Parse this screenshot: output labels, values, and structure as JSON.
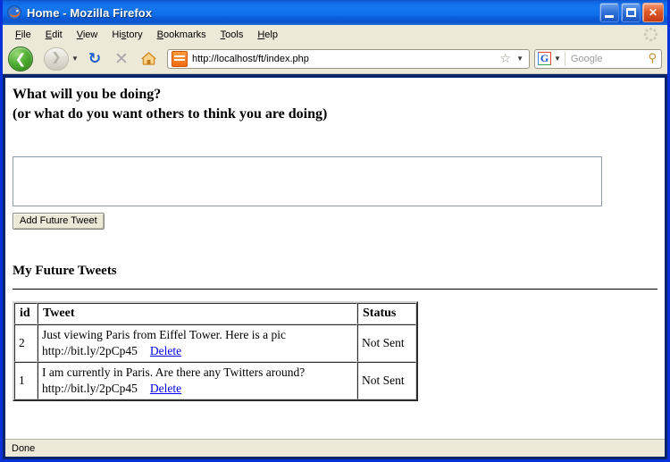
{
  "window": {
    "title": "Home - Mozilla Firefox",
    "app_icon": "firefox-icon",
    "buttons": {
      "minimize": "minimize-button",
      "maximize": "maximize-button",
      "close": "✕"
    }
  },
  "menubar": {
    "items": [
      {
        "label": "File",
        "accel": "F"
      },
      {
        "label": "Edit",
        "accel": "E"
      },
      {
        "label": "View",
        "accel": "V"
      },
      {
        "label": "History",
        "accel": "s"
      },
      {
        "label": "Bookmarks",
        "accel": "B"
      },
      {
        "label": "Tools",
        "accel": "T"
      },
      {
        "label": "Help",
        "accel": "H"
      }
    ]
  },
  "toolbar": {
    "back_icon": "❮",
    "forward_icon": "❯",
    "nav_dropdown_icon": "▼",
    "reload_icon": "↻",
    "stop_icon": "✕",
    "home_icon": "⌂",
    "url": "http://localhost/ft/index.php",
    "star_icon": "☆",
    "url_dropdown_icon": "▼",
    "search_engine": "G",
    "search_dropdown_icon": "▼",
    "search_placeholder": "Google",
    "magnifier_icon": "⚲"
  },
  "page": {
    "heading_line1": "What will you be doing?",
    "heading_line2": "(or what do you want others to think you are doing)",
    "textarea_value": "",
    "textarea_placeholder": "",
    "submit_label": "Add Future Tweet",
    "list_title": "My Future Tweets",
    "table": {
      "columns": [
        "id",
        "Tweet",
        "Status"
      ],
      "rows": [
        {
          "id": "2",
          "text": "Just viewing Paris from Eiffel Tower. Here is a pic",
          "url": "http://bit.ly/2pCp45",
          "delete_label": "Delete",
          "status": "Not Sent"
        },
        {
          "id": "1",
          "text": "I am currently in Paris. Are there any Twitters around?",
          "url": "http://bit.ly/2pCp45",
          "delete_label": "Delete",
          "status": "Not Sent"
        }
      ]
    }
  },
  "statusbar": {
    "text": "Done"
  },
  "colors": {
    "titlebar_blue": "#0f6dea",
    "frame_blue": "#0831d9",
    "chrome_beige": "#ece9d8",
    "link_blue": "#0000ee",
    "back_green": "#4fae32",
    "close_red": "#e05a28"
  }
}
